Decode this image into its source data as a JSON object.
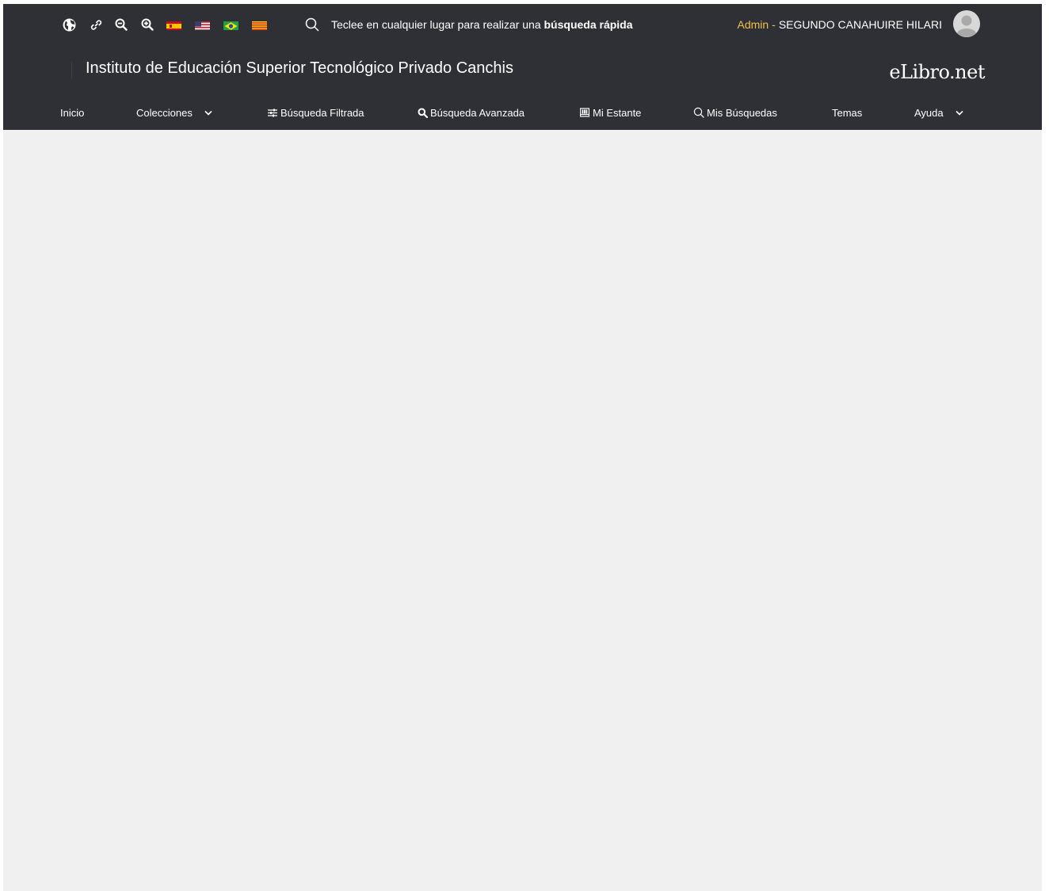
{
  "topbar": {
    "tools": [
      {
        "icon": "globe-icon"
      },
      {
        "icon": "link-icon"
      },
      {
        "icon": "zoom-out-icon"
      },
      {
        "icon": "zoom-in-icon"
      }
    ],
    "flags": [
      {
        "icon": "flag-spain-icon"
      },
      {
        "icon": "flag-usa-icon"
      },
      {
        "icon": "flag-brazil-icon"
      },
      {
        "icon": "flag-catalonia-icon"
      }
    ],
    "search": {
      "icon": "search-icon",
      "text_prefix": "Teclee en cualquier lugar para realizar una",
      "text_bold": "búsqueda rápida"
    },
    "user": {
      "role": "Admin",
      "separator": "-",
      "name": "SEGUNDO CANAHUIRE HILARI",
      "avatar_icon": "user-avatar-icon"
    }
  },
  "header": {
    "institution": "Instituto de Educación Superior Tecnológico Privado Canchis",
    "brand": "eLibro.net"
  },
  "nav": {
    "items": [
      {
        "label": "Inicio",
        "icon": ""
      },
      {
        "label": "Colecciones",
        "icon": "",
        "dropdown": true
      },
      {
        "label": "Búsqueda Filtrada",
        "icon": "sliders-icon"
      },
      {
        "label": "Búsqueda Avanzada",
        "icon": "search-icon"
      },
      {
        "label": "Mi Estante",
        "icon": "shelf-icon"
      },
      {
        "label": "Mis Búsquedas",
        "icon": "search-outline-icon"
      },
      {
        "label": "Temas",
        "icon": ""
      },
      {
        "label": "Ayuda",
        "icon": "",
        "dropdown": true
      }
    ]
  },
  "colors": {
    "header_bg": "#2f3035",
    "content_bg": "#f0f0f0",
    "role_accent": "#f0c24b"
  }
}
